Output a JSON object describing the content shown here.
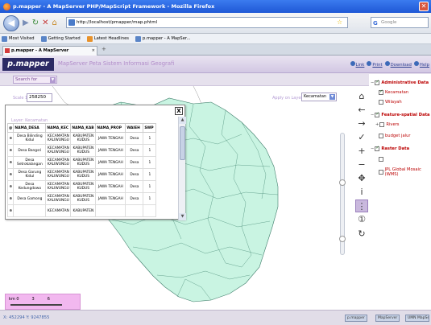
{
  "window": {
    "title": "p.mapper - A MapServer PHP/MapScript Framework - Mozilla Firefox",
    "close_glyph": "✕"
  },
  "browser": {
    "url": "http://localhost/pmapper/map.phtml",
    "search_placeholder": "Google",
    "bookmarks": [
      "Most Visited",
      "Getting Started",
      "Latest Headlines",
      "p.mapper - A MapSer..."
    ],
    "tab": {
      "label": "p.mapper - A MapServer PHP/MapSc...",
      "close": "×"
    },
    "newtab": "+"
  },
  "app": {
    "logo": "p.mapper",
    "title": "MapServer Peta Sistem Informasi Geografi",
    "links": [
      "Link",
      "Print",
      "Download",
      "Help"
    ]
  },
  "toolbar": {
    "search_for": "Search for",
    "dropdown_arrow": "▼"
  },
  "map": {
    "scale_label": "Scale 1:",
    "scale_value": "258250",
    "apply_label": "Apply on Layer",
    "apply_value": "Kecamatan",
    "dropdown_arrow": "▼"
  },
  "layer_window": {
    "title": "Layer: Kecamatan",
    "close_glyph": "X",
    "columns": [
      "@",
      "NAMA_DESA",
      "NAMA_KEC",
      "NAMA_KAB",
      "NAMA_PROP",
      "WAIEH",
      "SWP"
    ],
    "rows": [
      [
        "Desa Bilinding Kidul",
        "KECAMATAN KALIWUNGU",
        "KABUPATEN KUDUS",
        "JAWA TENGAH",
        "Desa",
        "1"
      ],
      [
        "Desa Bangsri",
        "KECAMATAN KALIWUNGU",
        "KABUPATEN KUDUS",
        "JAWA TENGAH",
        "Desa",
        "1"
      ],
      [
        "Desa Setrokalangan",
        "KECAMATAN KALIWUNGU",
        "KABUPATEN KUDUS",
        "JAWA TENGAH",
        "Desa",
        "1"
      ],
      [
        "Desa Garung Kidul",
        "KECAMATAN KALIWUNGU",
        "KABUPATEN KUDUS",
        "JAWA TENGAH",
        "Desa",
        "1"
      ],
      [
        "Desa Kedungdowo",
        "KECAMATAN KALIWUNGU",
        "KABUPATEN KUDUS",
        "JAWA TENGAH",
        "Desa",
        "1"
      ],
      [
        "Desa Gamong",
        "KECAMATAN KALIWUNGU",
        "KABUPATEN KUDUS",
        "JAWA TENGAH",
        "Desa",
        "1"
      ],
      [
        "",
        "KECAMATAN",
        "KABUPATEN",
        "",
        "",
        ""
      ]
    ]
  },
  "legend": {
    "groups": [
      {
        "label": "Administrative Data",
        "items": [
          "Kecamatan",
          "Wilayah"
        ]
      },
      {
        "label": "Feature-spatial Data",
        "items": [
          "Rivers",
          "budget jalur"
        ]
      },
      {
        "label": "Raster Data",
        "items": [
          "",
          "JPL Global Mosaic (WMS)"
        ]
      }
    ]
  },
  "scale_ticks": [
    "km 0",
    "3",
    "6"
  ],
  "status": {
    "coords": "X: 452294   Y: 9247855",
    "buttons": [
      "p.mapper",
      "MapServer",
      "UMN MapServer"
    ]
  },
  "icons": {
    "tools": [
      "home-icon",
      "arrow-left-icon",
      "arrow-right-icon",
      "zoom-in-icon",
      "zoom-out-icon",
      "pan-icon",
      "identify-icon",
      "select-icon",
      "measure-icon",
      "reload-icon"
    ]
  }
}
